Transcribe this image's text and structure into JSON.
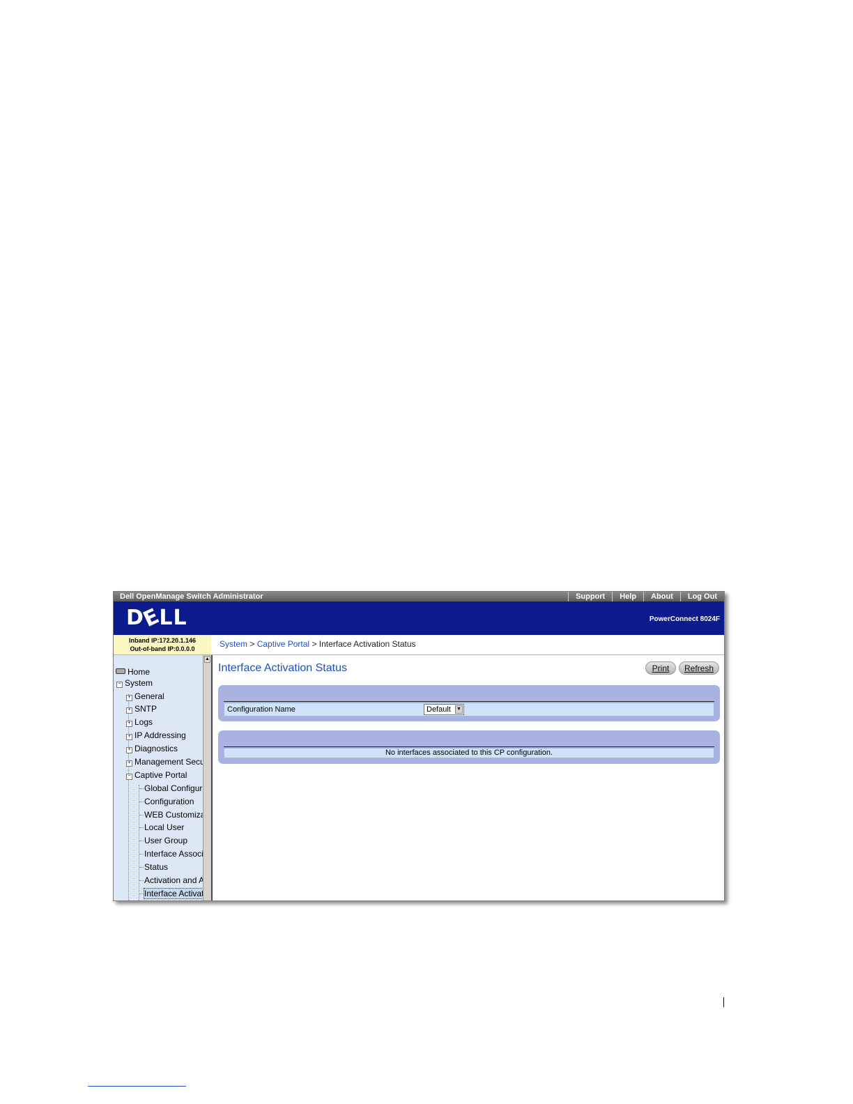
{
  "window": {
    "title": "Dell OpenManage Switch Administrator",
    "top_links": [
      "Support",
      "Help",
      "About",
      "Log Out"
    ],
    "brand": "DELL",
    "product": "PowerConnect 8024F",
    "inband_ip": "Inband IP:172.20.1.146",
    "outband_ip": "Out-of-band IP:0.0.0.0"
  },
  "breadcrumb": {
    "system": "System",
    "captive_portal": "Captive Portal",
    "sep": ">",
    "current": "Interface Activation Status"
  },
  "sidebar": {
    "home": "Home",
    "system": "System",
    "items": [
      "General",
      "SNTP",
      "Logs",
      "IP Addressing",
      "Diagnostics",
      "Management Securi",
      "Captive Portal"
    ],
    "sub_items": [
      "Global Configurat",
      "Configuration",
      "WEB Customiza",
      "Local User",
      "User Group",
      "Interface Associa",
      "Status",
      "Activation and Ac",
      "Interface Activati"
    ]
  },
  "main": {
    "title": "Interface Activation Status",
    "print_label": "Print",
    "refresh_label": "Refresh",
    "config_label": "Configuration Name",
    "config_value": "Default",
    "empty_message": "No interfaces associated to this CP configuration."
  }
}
